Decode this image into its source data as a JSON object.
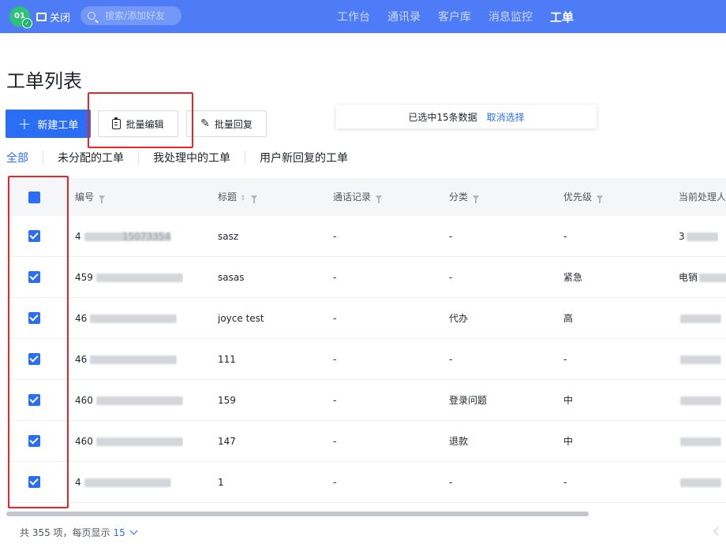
{
  "topbar": {
    "logo_text": "01",
    "close_label": "关闭",
    "search_placeholder": "搜索/添加好友",
    "nav": [
      "工作台",
      "通讯录",
      "客户库",
      "消息监控",
      "工单"
    ],
    "active_nav": "工单",
    "bar_color": "#4e7cf6"
  },
  "page": {
    "title": "工单列表",
    "new_button": "新建工单",
    "batch_edit": "批量编辑",
    "batch_reply": "批量回复",
    "selection_text": "已选中15条数据",
    "cancel_selection": "取消选择",
    "accent_color": "#2a6ef5",
    "highlight_color": "#e8262a"
  },
  "tabs": [
    "全部",
    "未分配的工单",
    "我处理中的工单",
    "用户新回复的工单"
  ],
  "table": {
    "columns": [
      "编号",
      "标题",
      "通话记录",
      "分类",
      "优先级",
      "当前处理人"
    ],
    "rows": [
      {
        "id": "4",
        "id_tail": "15073354335",
        "title": "sasz",
        "call": "-",
        "category": "-",
        "priority": "-",
        "handler": "3",
        "checked": true
      },
      {
        "id": "459",
        "id_tail": "",
        "title": "sasas",
        "call": "-",
        "category": "-",
        "priority": "紧急",
        "handler": "电销",
        "checked": true
      },
      {
        "id": "46",
        "id_tail": "",
        "title": "joyce test",
        "call": "-",
        "category": "代办",
        "priority": "高",
        "handler": "",
        "checked": true
      },
      {
        "id": "46",
        "id_tail": "",
        "title": "111",
        "call": "-",
        "category": "-",
        "priority": "-",
        "handler": "",
        "checked": true
      },
      {
        "id": "460",
        "id_tail": "",
        "title": "159",
        "call": "-",
        "category": "登录问题",
        "priority": "中",
        "handler": "",
        "checked": true
      },
      {
        "id": "460",
        "id_tail": "",
        "title": "147",
        "call": "-",
        "category": "退款",
        "priority": "中",
        "handler": "",
        "checked": true
      },
      {
        "id": "4",
        "id_tail": "",
        "title": "1",
        "call": "-",
        "category": "-",
        "priority": "-",
        "handler": "",
        "checked": true
      }
    ]
  },
  "footer": {
    "total_text": "共 355 项，每页显示",
    "page_size": "15"
  }
}
